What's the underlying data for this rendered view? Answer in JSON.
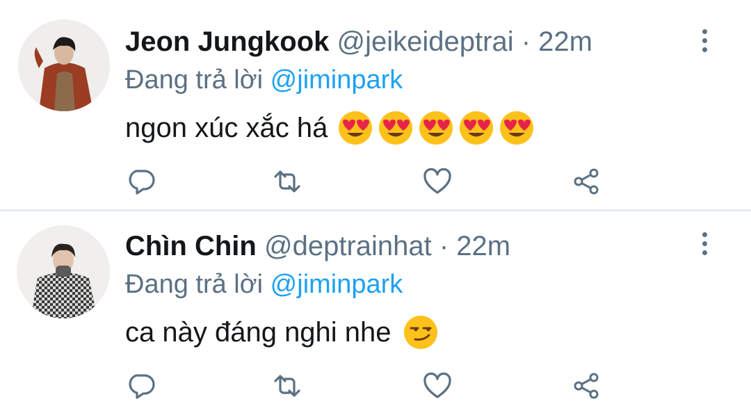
{
  "tweets": [
    {
      "display_name": "Jeon Jungkook",
      "handle": "@jeikeideptrai",
      "separator": " · ",
      "time": "22m",
      "replying_prefix": "Đang trả lời ",
      "replying_to": "@jiminpark",
      "text": "ngon xúc xắc há",
      "emojis": [
        "heart-eyes",
        "heart-eyes",
        "heart-eyes",
        "heart-eyes",
        "heart-eyes"
      ]
    },
    {
      "display_name": "Chìn Chin",
      "handle": "@deptrainhat",
      "separator": " · ",
      "time": "22m",
      "replying_prefix": "Đang trả lời ",
      "replying_to": "@jiminpark",
      "text": "ca này đáng nghi nhe",
      "emojis": [
        "smirk"
      ]
    }
  ],
  "colors": {
    "name": "#14171a",
    "secondary": "#5b7083",
    "mention": "#1da1f2",
    "divider": "#e6ecf0",
    "emoji_face": "#fcc21b",
    "emoji_heart": "#e8234a"
  },
  "icons": {
    "reply": "comment-bubble-icon",
    "retweet": "retweet-arrows-icon",
    "like": "heart-outline-icon",
    "share": "share-nodes-icon",
    "more": "vertical-dots-icon"
  }
}
